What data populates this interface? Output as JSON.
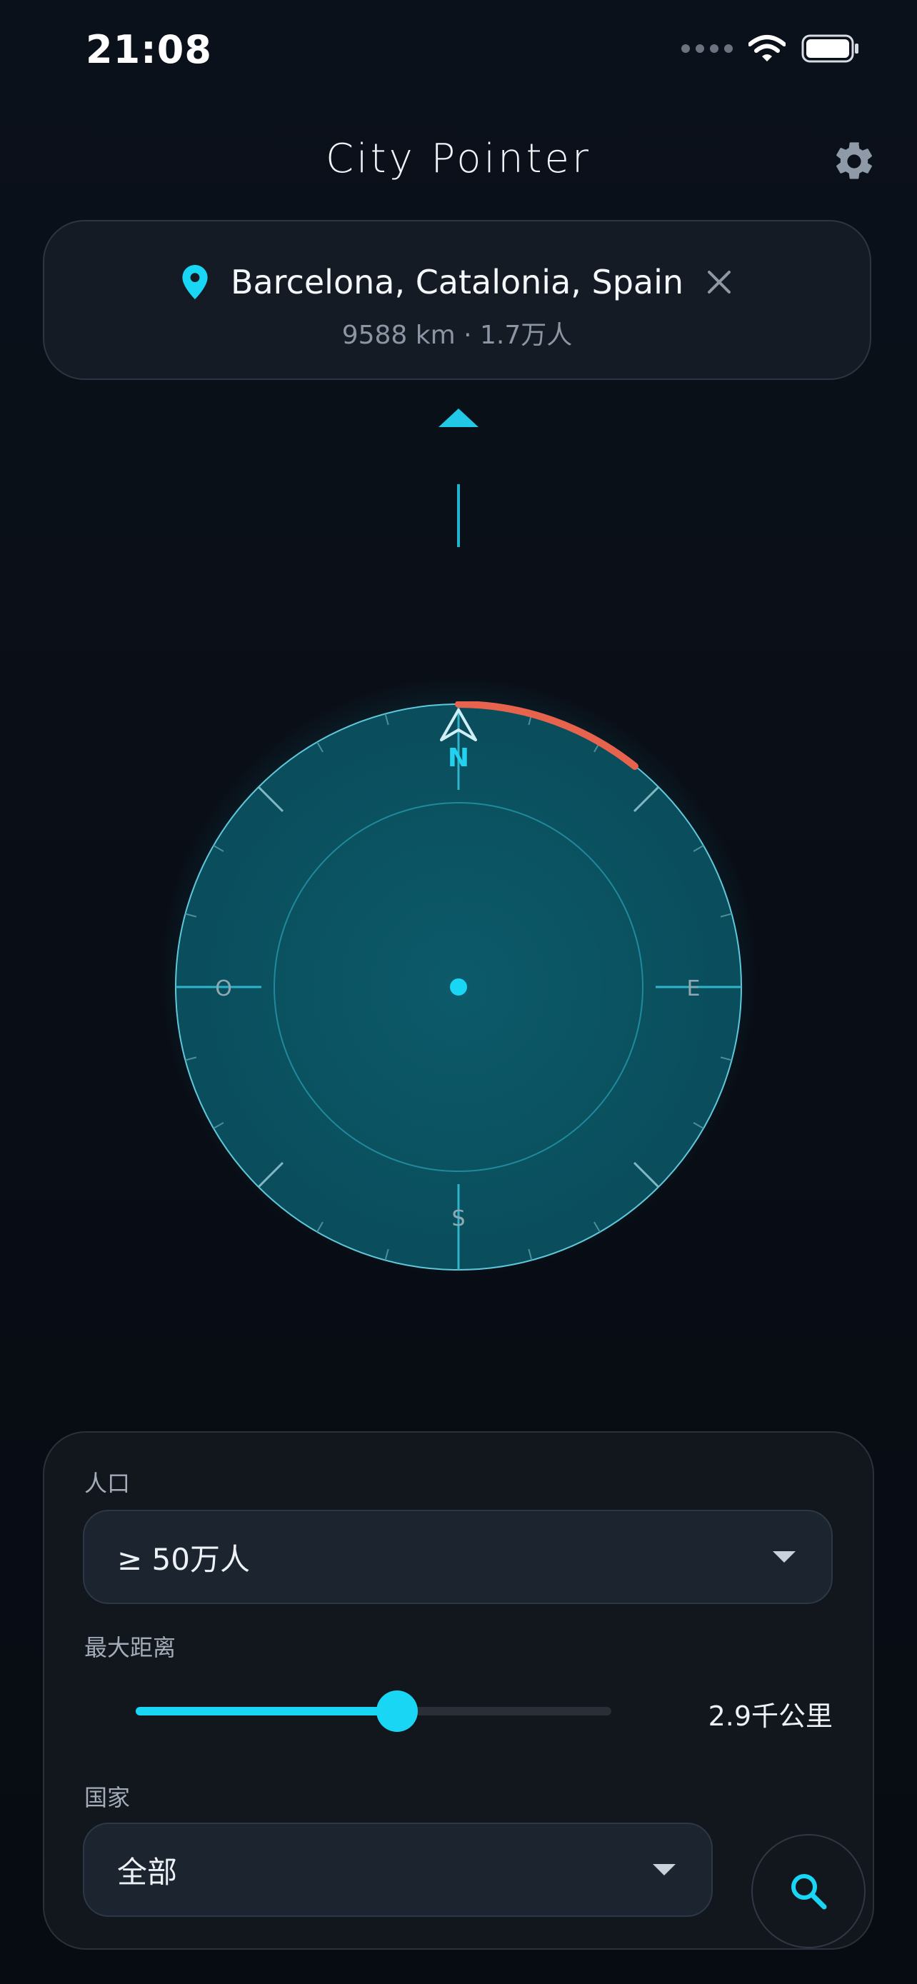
{
  "status_bar": {
    "time": "21:08"
  },
  "header": {
    "title": "City Pointer"
  },
  "destination": {
    "name": "Barcelona, Catalonia, Spain",
    "subtitle": "9588 km · 1.7万人"
  },
  "compass": {
    "labels": {
      "north": "N",
      "east": "E",
      "south": "S",
      "west": "O"
    }
  },
  "filters": {
    "population": {
      "label": "人口",
      "value": "≥ 50万人"
    },
    "max_distance": {
      "label": "最大距离",
      "value_text": "2.9千公里",
      "fraction": 0.55
    },
    "country": {
      "label": "国家",
      "value": "全部"
    }
  },
  "colors": {
    "accent": "#19d6f5",
    "arc": "#e8634d",
    "background": "#0b111a"
  },
  "icons": [
    "gear-icon",
    "location-pin-icon",
    "close-icon",
    "chevron-down-icon",
    "search-icon",
    "wifi-icon",
    "battery-icon",
    "signal-icon"
  ]
}
